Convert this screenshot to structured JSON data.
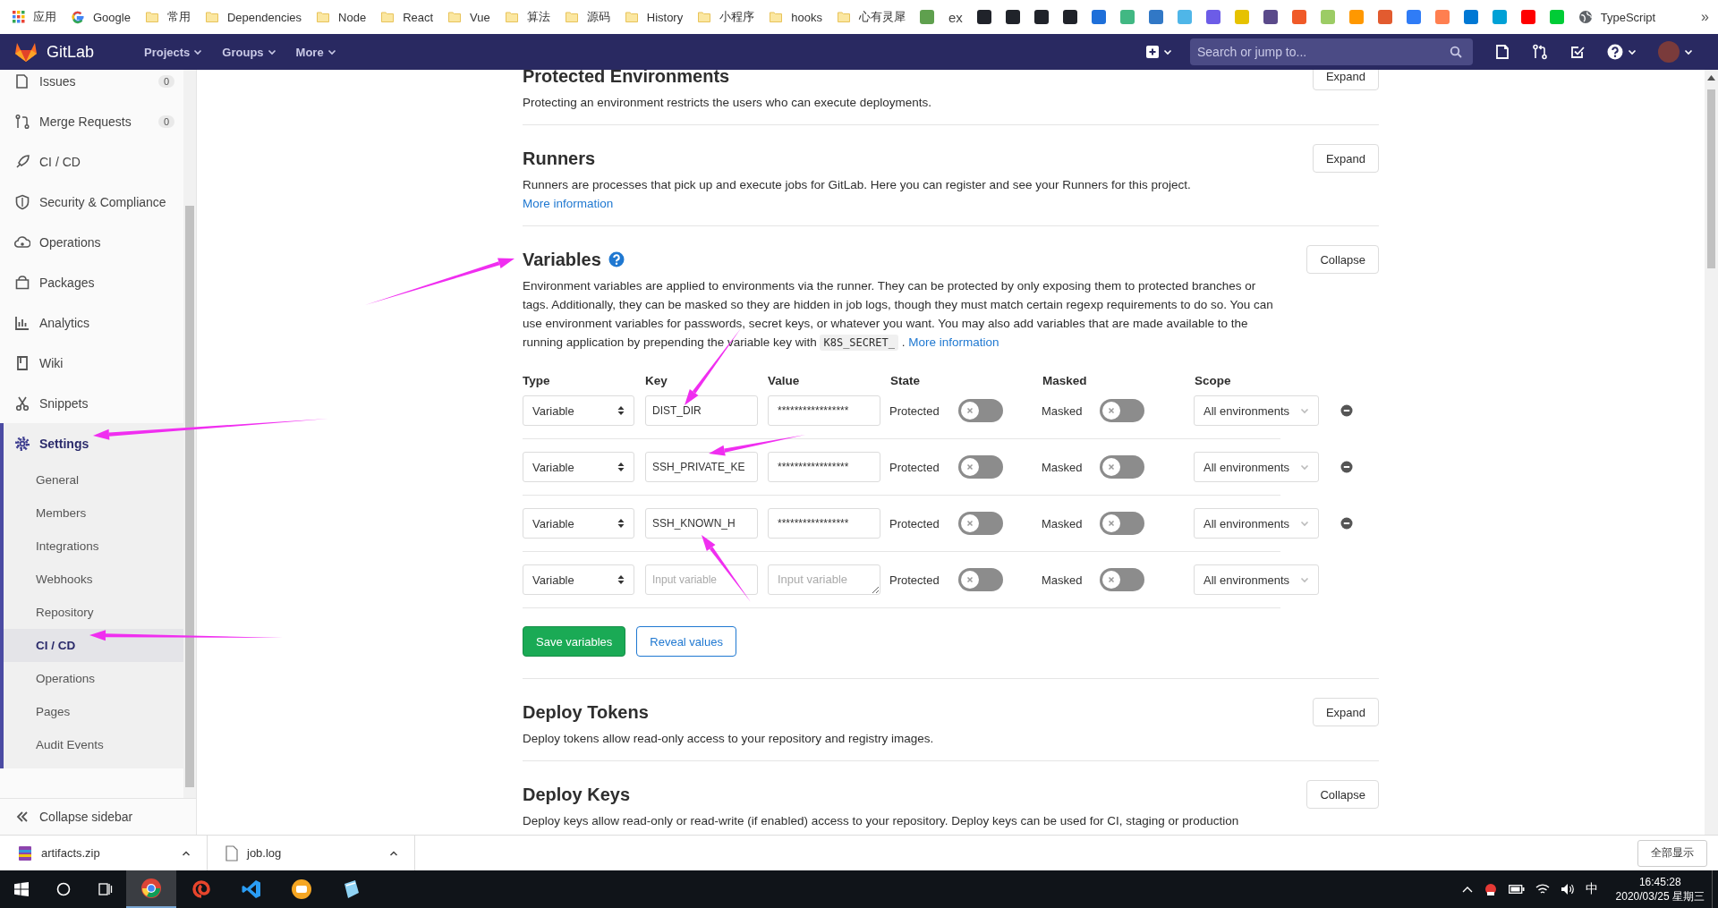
{
  "bookmarks_bar": {
    "items": [
      {
        "kind": "apps",
        "label": "应用"
      },
      {
        "kind": "site",
        "label": "Google"
      },
      {
        "kind": "folder",
        "label": "常用"
      },
      {
        "kind": "folder",
        "label": "Dependencies"
      },
      {
        "kind": "folder",
        "label": "Node"
      },
      {
        "kind": "folder",
        "label": "React"
      },
      {
        "kind": "folder",
        "label": "Vue"
      },
      {
        "kind": "folder",
        "label": "算法"
      },
      {
        "kind": "folder",
        "label": "源码"
      },
      {
        "kind": "folder",
        "label": "History"
      },
      {
        "kind": "folder",
        "label": "小程序"
      },
      {
        "kind": "folder",
        "label": "hooks"
      },
      {
        "kind": "folder",
        "label": "心有灵犀"
      },
      {
        "kind": "icon",
        "color": "#5fa04e"
      },
      {
        "kind": "text",
        "label": "ex"
      },
      {
        "kind": "icon",
        "color": "#20232a"
      },
      {
        "kind": "icon",
        "color": "#20232a"
      },
      {
        "kind": "icon",
        "color": "#20232a"
      },
      {
        "kind": "icon",
        "color": "#20232a"
      },
      {
        "kind": "icon",
        "color": "#1e6fd9"
      },
      {
        "kind": "icon",
        "color": "#41b883"
      },
      {
        "kind": "icon",
        "color": "#3178c6"
      },
      {
        "kind": "icon",
        "color": "#4fb6e8"
      },
      {
        "kind": "icon",
        "color": "#6c5ce7"
      },
      {
        "kind": "icon",
        "color": "#e6c200"
      },
      {
        "kind": "icon",
        "color": "#5a4a8a"
      },
      {
        "kind": "icon",
        "color": "#f05a28"
      },
      {
        "kind": "icon",
        "color": "#9ccc65"
      },
      {
        "kind": "icon",
        "color": "#ff9800"
      },
      {
        "kind": "icon",
        "color": "#e25b2f"
      },
      {
        "kind": "icon",
        "color": "#2f7cf6"
      },
      {
        "kind": "icon",
        "color": "#ff7f50"
      },
      {
        "kind": "icon",
        "color": "#0078d4"
      },
      {
        "kind": "icon",
        "color": "#00a1d6"
      },
      {
        "kind": "icon",
        "color": "#ff0000"
      },
      {
        "kind": "icon",
        "color": "#00cc36"
      },
      {
        "kind": "site",
        "label": "TypeScript"
      }
    ],
    "overflow": "»"
  },
  "navbar": {
    "brand": "GitLab",
    "menus": [
      "Projects",
      "Groups",
      "More"
    ],
    "search": {
      "placeholder": "Search or jump to..."
    }
  },
  "sidebar": {
    "items": [
      {
        "label": "Issues",
        "count": "0",
        "selected": false,
        "expanded": false
      },
      {
        "label": "Merge Requests",
        "count": "0",
        "selected": false,
        "expanded": false
      },
      {
        "label": "CI / CD",
        "selected": false,
        "expanded": false
      },
      {
        "label": "Security & Compliance",
        "selected": false,
        "expanded": false
      },
      {
        "label": "Operations",
        "selected": false,
        "expanded": false
      },
      {
        "label": "Packages",
        "selected": false,
        "expanded": false
      },
      {
        "label": "Analytics",
        "selected": false,
        "expanded": false
      },
      {
        "label": "Wiki",
        "selected": false,
        "expanded": false
      },
      {
        "label": "Snippets",
        "selected": false,
        "expanded": false
      },
      {
        "label": "Settings",
        "selected": true,
        "expanded": true,
        "children": [
          {
            "label": "General",
            "selected": false
          },
          {
            "label": "Members",
            "selected": false
          },
          {
            "label": "Integrations",
            "selected": false
          },
          {
            "label": "Webhooks",
            "selected": false
          },
          {
            "label": "Repository",
            "selected": false
          },
          {
            "label": "CI / CD",
            "selected": true
          },
          {
            "label": "Operations",
            "selected": false
          },
          {
            "label": "Pages",
            "selected": false
          },
          {
            "label": "Audit Events",
            "selected": false
          }
        ]
      }
    ],
    "collapse_label": "Collapse sidebar"
  },
  "sections": [
    {
      "title": "Protected Environments",
      "button": "Expand",
      "description": [
        {
          "kind": "text",
          "text": "Protecting an environment restricts the users who can execute deployments."
        }
      ]
    },
    {
      "title": "Runners",
      "button": "Expand",
      "description": [
        {
          "kind": "text",
          "text": "Runners are processes that pick up and execute jobs for GitLab. Here you can register and see your Runners for this project. "
        },
        {
          "kind": "link",
          "text": "More information"
        }
      ]
    },
    {
      "title": "Variables",
      "help": true,
      "button": "Collapse",
      "description": [
        {
          "kind": "text",
          "text": "Environment variables are applied to environments via the runner. They can be protected by only exposing them to protected branches or tags. Additionally, they can be masked so they are hidden in job logs, though they must match certain regexp requirements to do so. You can use environment variables for passwords, secret keys, or whatever you want. You may also add variables that are made available to the running application by prepending the variable key with "
        },
        {
          "kind": "code",
          "text": "K8S_SECRET_"
        },
        {
          "kind": "text",
          "text": " . "
        },
        {
          "kind": "link",
          "text": "More information"
        }
      ],
      "variables": {
        "columns": [
          "Type",
          "Key",
          "Value",
          "State",
          "Masked",
          "Scope"
        ],
        "rows": [
          {
            "type": "Variable",
            "key": "DIST_DIR",
            "value": "*****************",
            "protected_label": "Protected",
            "protected": false,
            "masked_label": "Masked",
            "masked": false,
            "scope": "All environments",
            "removable": true
          },
          {
            "type": "Variable",
            "key": "SSH_PRIVATE_KE",
            "value": "*****************",
            "protected_label": "Protected",
            "protected": false,
            "masked_label": "Masked",
            "masked": false,
            "scope": "All environments",
            "removable": true
          },
          {
            "type": "Variable",
            "key": "SSH_KNOWN_H",
            "value": "*****************",
            "protected_label": "Protected",
            "protected": false,
            "masked_label": "Masked",
            "masked": false,
            "scope": "All environments",
            "removable": true
          },
          {
            "type": "Variable",
            "key_placeholder": "Input variable",
            "value_placeholder": "Input variable",
            "protected_label": "Protected",
            "protected": false,
            "masked_label": "Masked",
            "masked": false,
            "scope": "All environments",
            "removable": false
          }
        ],
        "buttons": [
          {
            "label": "Save variables",
            "kind": "primary"
          },
          {
            "label": "Reveal values",
            "kind": "secondary"
          }
        ]
      }
    },
    {
      "title": "Deploy Tokens",
      "button": "Expand",
      "description": [
        {
          "kind": "text",
          "text": "Deploy tokens allow read-only access to your repository and registry images."
        }
      ]
    },
    {
      "title": "Deploy Keys",
      "button": "Collapse",
      "description": [
        {
          "kind": "text",
          "text": "Deploy keys allow read-only or read-write (if enabled) access to your repository. Deploy keys can be used for CI, staging or production"
        }
      ]
    }
  ],
  "downloads": {
    "items": [
      {
        "name": "artifacts.zip",
        "kind": "archive"
      },
      {
        "name": "job.log",
        "kind": "file"
      }
    ],
    "show_all": "全部显示"
  },
  "taskbar": {
    "apps": [
      {
        "selected": true
      },
      {
        "selected": false
      },
      {
        "selected": false
      },
      {
        "selected": false
      },
      {
        "selected": false
      }
    ],
    "ime": "中",
    "time": "16:45:28",
    "date": "2020/03/25 星期三"
  }
}
